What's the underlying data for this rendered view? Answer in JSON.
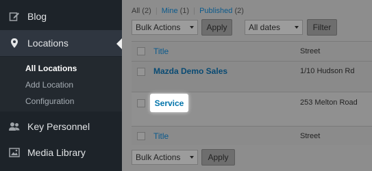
{
  "sidebar": {
    "items": [
      {
        "label": "Blog",
        "icon": "edit-icon"
      },
      {
        "label": "Locations",
        "icon": "map-pin-icon"
      },
      {
        "label": "Key Personnel",
        "icon": "users-icon"
      },
      {
        "label": "Media Library",
        "icon": "media-icon"
      }
    ],
    "submenu": [
      {
        "label": "All Locations"
      },
      {
        "label": "Add Location"
      },
      {
        "label": "Configuration"
      }
    ]
  },
  "filters": {
    "all": "All",
    "all_count": "(2)",
    "mine": "Mine",
    "mine_count": "(1)",
    "published": "Published",
    "published_count": "(2)",
    "separator": "|"
  },
  "toolbar": {
    "bulk_actions": "Bulk Actions",
    "apply": "Apply",
    "dates": "All dates",
    "filter": "Filter"
  },
  "table": {
    "columns": {
      "title": "Title",
      "street": "Street"
    },
    "rows": [
      {
        "title": "Mazda Demo Sales",
        "street": "1/10 Hudson Rd"
      },
      {
        "title": "Service",
        "street": "253 Melton Road"
      }
    ]
  },
  "colors": {
    "sidebar_bg": "#1d2329",
    "link": "#0073aa",
    "overlay": "#8d8d8d"
  }
}
